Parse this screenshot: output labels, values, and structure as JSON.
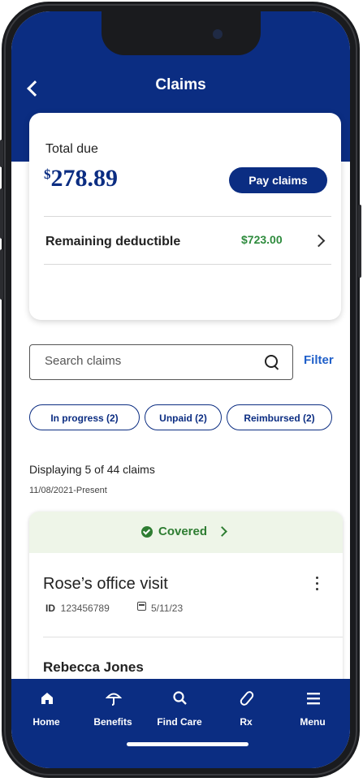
{
  "header": {
    "title": "Claims",
    "back_icon": "chevron-left-icon"
  },
  "summary": {
    "total_label": "Total due",
    "currency_symbol": "$",
    "total_amount": "278.89",
    "pay_button": "Pay claims",
    "deductible_label": "Remaining deductible",
    "deductible_value": "$723.00"
  },
  "search": {
    "placeholder": "Search claims",
    "filter_label": "Filter"
  },
  "chips": [
    "In progress (2)",
    "Unpaid (2)",
    "Reimbursed (2)"
  ],
  "listing": {
    "displaying": "Displaying 5 of 44 claims",
    "range": "11/08/2021-Present"
  },
  "claim": {
    "status": "Covered",
    "title": "Rose’s office visit",
    "id_label": "ID",
    "id_value": "123456789",
    "date": "5/11/23",
    "patient": "Rebecca Jones"
  },
  "nav": [
    {
      "label": "Home",
      "icon": "home-icon"
    },
    {
      "label": "Benefits",
      "icon": "umbrella-icon"
    },
    {
      "label": "Find Care",
      "icon": "search-icon"
    },
    {
      "label": "Rx",
      "icon": "pill-icon"
    },
    {
      "label": "Menu",
      "icon": "menu-icon"
    }
  ],
  "colors": {
    "brand": "#0b2d82",
    "success": "#2e8b3d",
    "link": "#1f5fc9"
  }
}
